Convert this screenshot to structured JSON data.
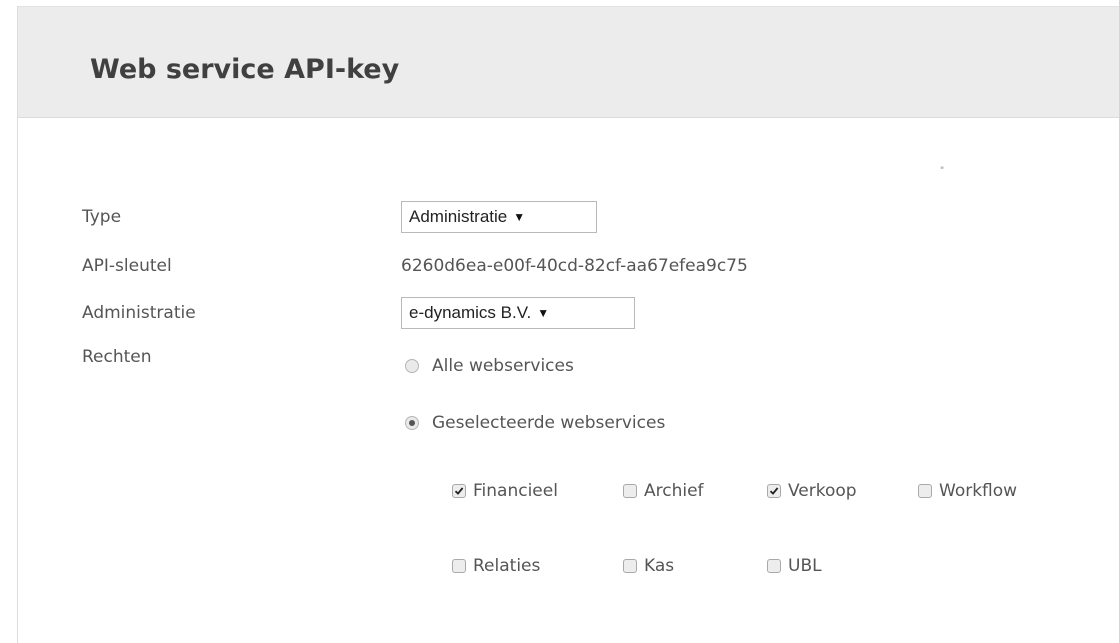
{
  "header": {
    "title": "Web service API-key"
  },
  "stray_mark": "\"",
  "form": {
    "type": {
      "label": "Type",
      "selected": "Administratie"
    },
    "api_key": {
      "label": "API-sleutel",
      "value": "6260d6ea-e00f-40cd-82cf-aa67efea9c75"
    },
    "administration": {
      "label": "Administratie",
      "selected": "e-dynamics B.V."
    },
    "rights": {
      "label": "Rechten",
      "options": [
        {
          "label": "Alle webservices",
          "checked": false
        },
        {
          "label": "Geselecteerde webservices",
          "checked": true
        }
      ],
      "services": [
        {
          "label": "Financieel",
          "checked": true
        },
        {
          "label": "Archief",
          "checked": false
        },
        {
          "label": "Verkoop",
          "checked": true
        },
        {
          "label": "Workflow",
          "checked": false
        },
        {
          "label": "Relaties",
          "checked": false
        },
        {
          "label": "Kas",
          "checked": false
        },
        {
          "label": "UBL",
          "checked": false
        }
      ]
    }
  },
  "icons": {
    "dropdown": "triangle-down-icon",
    "check": "checkmark-icon"
  }
}
